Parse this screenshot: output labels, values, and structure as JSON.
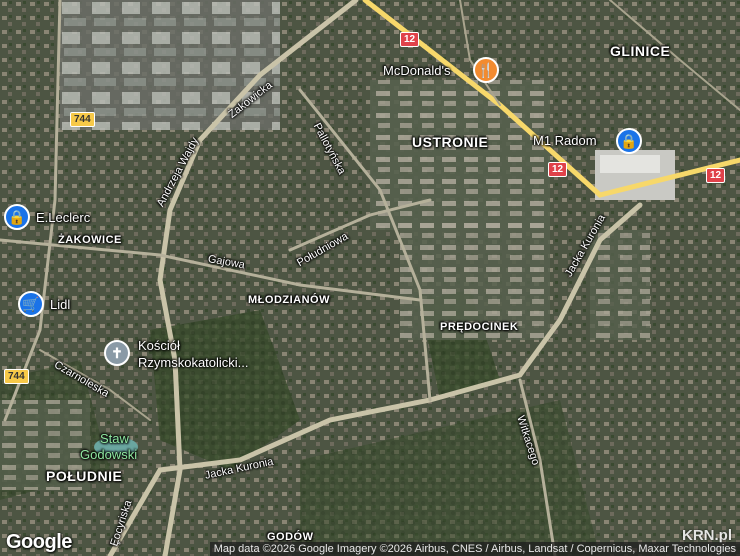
{
  "map": {
    "districts": {
      "glinice": "GLINICE",
      "ustronie": "USTRONIE",
      "zakowice": "ŻAKOWICE",
      "mlodzianow": "MŁODZIANÓW",
      "predocinek": "PRĘDOCINEK",
      "poludnie": "POŁUDNIE",
      "godow": "GODÓW"
    },
    "streets": {
      "zakowicka": "Żakowicka",
      "pallotynska": "Pallotyńska",
      "andrzeja_wajdy": "Andrzeja Wajdy",
      "poludniowa": "Południowa",
      "gajowa": "Gajowa",
      "jacka_kuronia_east": "Jacka Kuronia",
      "jacka_kuronia_south": "Jacka Kuronia",
      "czarnoleska": "Czarnoleska",
      "wilkacego": "Witkacego",
      "bocyriska": "Ȩocyriska"
    },
    "road_shields": {
      "r12_top": "12",
      "r12_mid": "12",
      "r12_right": "12",
      "r744_top": "744",
      "r744_bottom": "744"
    },
    "pois": {
      "mcdonalds": "McDonald's",
      "m1_radom": "M1 Radom",
      "eleclerc": "E.Leclerc",
      "lidl": "Lidl",
      "kosciol_line1": "Kościół",
      "kosciol_line2": "Rzymskokatolicki...",
      "staw_line1": "Staw",
      "staw_line2": "Godowski"
    },
    "icons": {
      "shop": "shopping-bag-icon",
      "food": "fork-knife-icon",
      "church": "cross-icon"
    },
    "colors": {
      "major_road": "#f7d86a",
      "road": "#c9c3a8",
      "water": "#6aa6a0",
      "shop_pin": "#1a73e8",
      "food_pin": "#f28b30"
    }
  },
  "footer": {
    "logo": "Google",
    "attribution": "Map data ©2026 Google Imagery ©2026 Airbus, CNES / Airbus, Landsat / Copernicus, Maxar Technologies",
    "watermark": "KRN.pl"
  }
}
